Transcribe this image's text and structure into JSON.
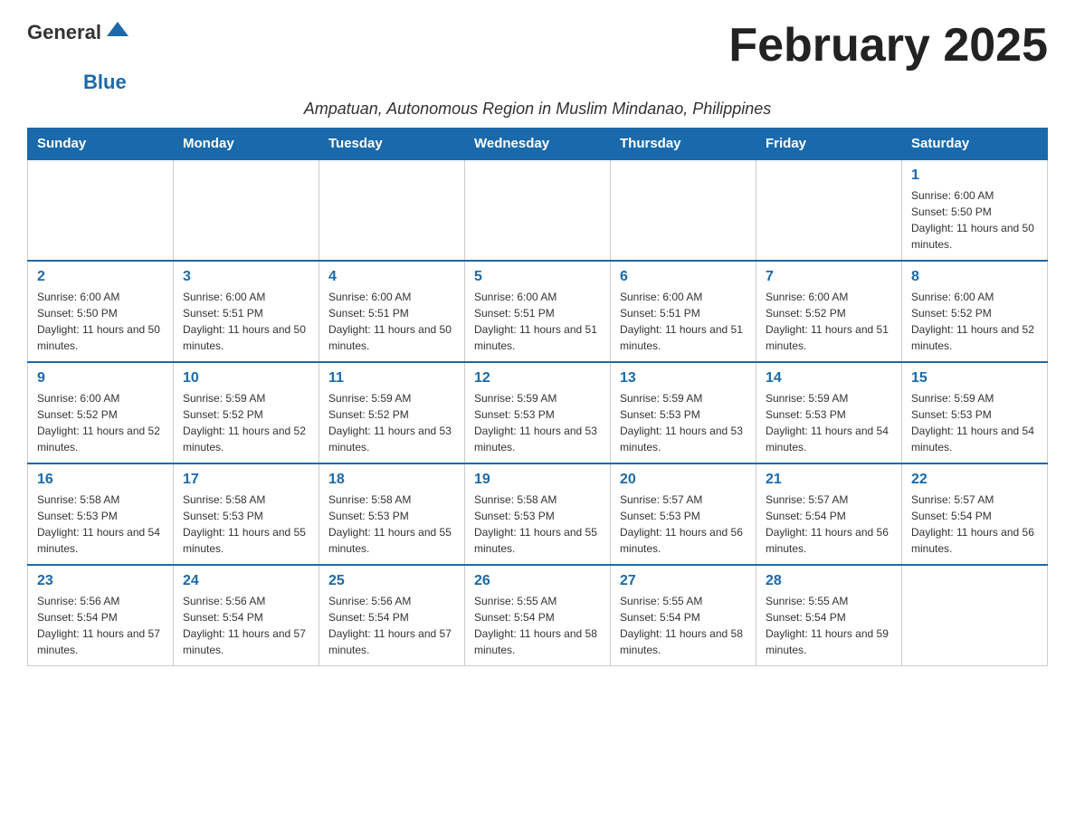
{
  "header": {
    "logo_general": "General",
    "logo_blue": "Blue",
    "month_title": "February 2025",
    "subtitle": "Ampatuan, Autonomous Region in Muslim Mindanao, Philippines"
  },
  "weekdays": [
    "Sunday",
    "Monday",
    "Tuesday",
    "Wednesday",
    "Thursday",
    "Friday",
    "Saturday"
  ],
  "weeks": [
    [
      {
        "day": "",
        "sunrise": "",
        "sunset": "",
        "daylight": ""
      },
      {
        "day": "",
        "sunrise": "",
        "sunset": "",
        "daylight": ""
      },
      {
        "day": "",
        "sunrise": "",
        "sunset": "",
        "daylight": ""
      },
      {
        "day": "",
        "sunrise": "",
        "sunset": "",
        "daylight": ""
      },
      {
        "day": "",
        "sunrise": "",
        "sunset": "",
        "daylight": ""
      },
      {
        "day": "",
        "sunrise": "",
        "sunset": "",
        "daylight": ""
      },
      {
        "day": "1",
        "sunrise": "Sunrise: 6:00 AM",
        "sunset": "Sunset: 5:50 PM",
        "daylight": "Daylight: 11 hours and 50 minutes."
      }
    ],
    [
      {
        "day": "2",
        "sunrise": "Sunrise: 6:00 AM",
        "sunset": "Sunset: 5:50 PM",
        "daylight": "Daylight: 11 hours and 50 minutes."
      },
      {
        "day": "3",
        "sunrise": "Sunrise: 6:00 AM",
        "sunset": "Sunset: 5:51 PM",
        "daylight": "Daylight: 11 hours and 50 minutes."
      },
      {
        "day": "4",
        "sunrise": "Sunrise: 6:00 AM",
        "sunset": "Sunset: 5:51 PM",
        "daylight": "Daylight: 11 hours and 50 minutes."
      },
      {
        "day": "5",
        "sunrise": "Sunrise: 6:00 AM",
        "sunset": "Sunset: 5:51 PM",
        "daylight": "Daylight: 11 hours and 51 minutes."
      },
      {
        "day": "6",
        "sunrise": "Sunrise: 6:00 AM",
        "sunset": "Sunset: 5:51 PM",
        "daylight": "Daylight: 11 hours and 51 minutes."
      },
      {
        "day": "7",
        "sunrise": "Sunrise: 6:00 AM",
        "sunset": "Sunset: 5:52 PM",
        "daylight": "Daylight: 11 hours and 51 minutes."
      },
      {
        "day": "8",
        "sunrise": "Sunrise: 6:00 AM",
        "sunset": "Sunset: 5:52 PM",
        "daylight": "Daylight: 11 hours and 52 minutes."
      }
    ],
    [
      {
        "day": "9",
        "sunrise": "Sunrise: 6:00 AM",
        "sunset": "Sunset: 5:52 PM",
        "daylight": "Daylight: 11 hours and 52 minutes."
      },
      {
        "day": "10",
        "sunrise": "Sunrise: 5:59 AM",
        "sunset": "Sunset: 5:52 PM",
        "daylight": "Daylight: 11 hours and 52 minutes."
      },
      {
        "day": "11",
        "sunrise": "Sunrise: 5:59 AM",
        "sunset": "Sunset: 5:52 PM",
        "daylight": "Daylight: 11 hours and 53 minutes."
      },
      {
        "day": "12",
        "sunrise": "Sunrise: 5:59 AM",
        "sunset": "Sunset: 5:53 PM",
        "daylight": "Daylight: 11 hours and 53 minutes."
      },
      {
        "day": "13",
        "sunrise": "Sunrise: 5:59 AM",
        "sunset": "Sunset: 5:53 PM",
        "daylight": "Daylight: 11 hours and 53 minutes."
      },
      {
        "day": "14",
        "sunrise": "Sunrise: 5:59 AM",
        "sunset": "Sunset: 5:53 PM",
        "daylight": "Daylight: 11 hours and 54 minutes."
      },
      {
        "day": "15",
        "sunrise": "Sunrise: 5:59 AM",
        "sunset": "Sunset: 5:53 PM",
        "daylight": "Daylight: 11 hours and 54 minutes."
      }
    ],
    [
      {
        "day": "16",
        "sunrise": "Sunrise: 5:58 AM",
        "sunset": "Sunset: 5:53 PM",
        "daylight": "Daylight: 11 hours and 54 minutes."
      },
      {
        "day": "17",
        "sunrise": "Sunrise: 5:58 AM",
        "sunset": "Sunset: 5:53 PM",
        "daylight": "Daylight: 11 hours and 55 minutes."
      },
      {
        "day": "18",
        "sunrise": "Sunrise: 5:58 AM",
        "sunset": "Sunset: 5:53 PM",
        "daylight": "Daylight: 11 hours and 55 minutes."
      },
      {
        "day": "19",
        "sunrise": "Sunrise: 5:58 AM",
        "sunset": "Sunset: 5:53 PM",
        "daylight": "Daylight: 11 hours and 55 minutes."
      },
      {
        "day": "20",
        "sunrise": "Sunrise: 5:57 AM",
        "sunset": "Sunset: 5:53 PM",
        "daylight": "Daylight: 11 hours and 56 minutes."
      },
      {
        "day": "21",
        "sunrise": "Sunrise: 5:57 AM",
        "sunset": "Sunset: 5:54 PM",
        "daylight": "Daylight: 11 hours and 56 minutes."
      },
      {
        "day": "22",
        "sunrise": "Sunrise: 5:57 AM",
        "sunset": "Sunset: 5:54 PM",
        "daylight": "Daylight: 11 hours and 56 minutes."
      }
    ],
    [
      {
        "day": "23",
        "sunrise": "Sunrise: 5:56 AM",
        "sunset": "Sunset: 5:54 PM",
        "daylight": "Daylight: 11 hours and 57 minutes."
      },
      {
        "day": "24",
        "sunrise": "Sunrise: 5:56 AM",
        "sunset": "Sunset: 5:54 PM",
        "daylight": "Daylight: 11 hours and 57 minutes."
      },
      {
        "day": "25",
        "sunrise": "Sunrise: 5:56 AM",
        "sunset": "Sunset: 5:54 PM",
        "daylight": "Daylight: 11 hours and 57 minutes."
      },
      {
        "day": "26",
        "sunrise": "Sunrise: 5:55 AM",
        "sunset": "Sunset: 5:54 PM",
        "daylight": "Daylight: 11 hours and 58 minutes."
      },
      {
        "day": "27",
        "sunrise": "Sunrise: 5:55 AM",
        "sunset": "Sunset: 5:54 PM",
        "daylight": "Daylight: 11 hours and 58 minutes."
      },
      {
        "day": "28",
        "sunrise": "Sunrise: 5:55 AM",
        "sunset": "Sunset: 5:54 PM",
        "daylight": "Daylight: 11 hours and 59 minutes."
      },
      {
        "day": "",
        "sunrise": "",
        "sunset": "",
        "daylight": ""
      }
    ]
  ]
}
